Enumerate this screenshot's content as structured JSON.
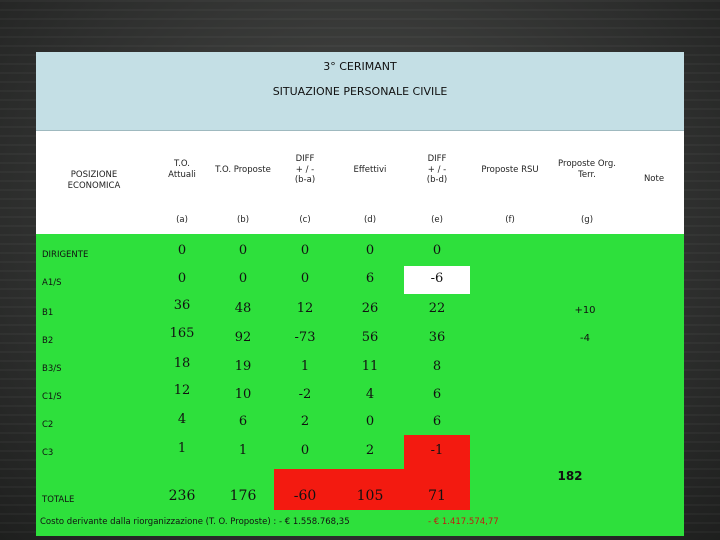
{
  "header": {
    "title": "3° CERIMANT",
    "subtitle": "SITUAZIONE PERSONALE CIVILE"
  },
  "columns": {
    "position": "POSIZIONE\nECONOMICA",
    "to_attuali": "T.O.\nAttuali",
    "to_proposte": "T.O. Proposte",
    "diff_ba": "DIFF\n+ / -\n(b-a)",
    "effettivi": "Effettivi",
    "diff_bd": "DIFF\n+ / -\n(b-d)",
    "proposte_rsu": "Proposte RSU",
    "proposte_org": "Proposte Org.\nTerr.",
    "note": "Note"
  },
  "subheaders": [
    "(a)",
    "(b)",
    "(c)",
    "(d)",
    "(e)",
    "(f)",
    "(g)"
  ],
  "rows": [
    {
      "label": "DIRIGENTE",
      "a": "0",
      "b": "0",
      "c": "0",
      "d": "0",
      "e": "0",
      "f": "",
      "g": ""
    },
    {
      "label": "A1/S",
      "a": "0",
      "b": "0",
      "c": "0",
      "d": "6",
      "e": "-6",
      "f": "",
      "g": ""
    },
    {
      "label": "B1",
      "a": "36",
      "b": "48",
      "c": "12",
      "d": "26",
      "e": "22",
      "f": "",
      "g": "+10"
    },
    {
      "label": "B2",
      "a": "165",
      "b": "92",
      "c": "-73",
      "d": "56",
      "e": "36",
      "f": "",
      "g": "-4"
    },
    {
      "label": "B3/S",
      "a": "18",
      "b": "19",
      "c": "1",
      "d": "11",
      "e": "8",
      "f": "",
      "g": ""
    },
    {
      "label": "C1/S",
      "a": "12",
      "b": "10",
      "c": "-2",
      "d": "4",
      "e": "6",
      "f": "",
      "g": ""
    },
    {
      "label": "C2",
      "a": "4",
      "b": "6",
      "c": "2",
      "d": "0",
      "e": "6",
      "f": "",
      "g": ""
    },
    {
      "label": "C3",
      "a": "1",
      "b": "1",
      "c": "0",
      "d": "2",
      "e": "-1",
      "f": "",
      "g": ""
    }
  ],
  "totale": {
    "label": "TOTALE",
    "a": "236",
    "b": "176",
    "c": "-60",
    "d": "105",
    "e": "71",
    "g_extra": "182"
  },
  "footer": {
    "costo_label": "Costo derivante dalla riorganizzazione (T. O. Proposte) : - € 1.558.768,35",
    "costo_red": "- € 1.417.574,77"
  },
  "colors": {
    "green": "#2ee03c",
    "red": "#f31a10",
    "header_bg": "#c4dfe5"
  }
}
